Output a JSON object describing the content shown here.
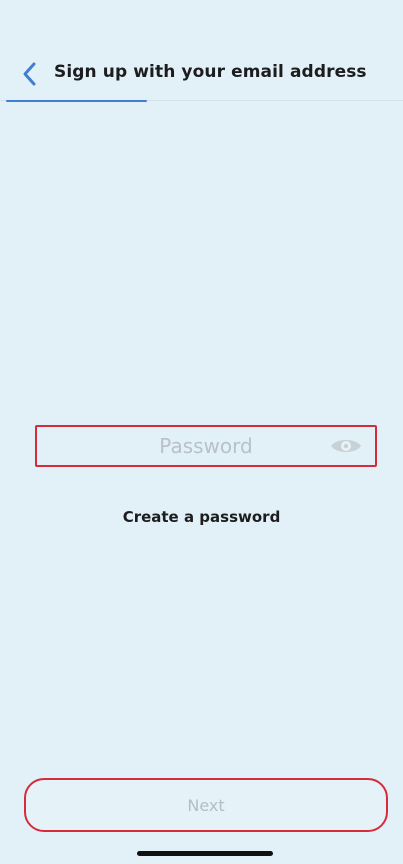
{
  "colors": {
    "background": "#e2f1f8",
    "accent": "#3f7ed0",
    "highlight": "#d62b3a"
  },
  "header": {
    "title": "Sign up with your email address",
    "back_icon": "chevron-left-icon",
    "progress": 0.35
  },
  "password_field": {
    "placeholder": "Password",
    "value": "",
    "visibility_icon": "eye-icon"
  },
  "helper": {
    "text": "Create a password"
  },
  "footer": {
    "next_label": "Next"
  }
}
